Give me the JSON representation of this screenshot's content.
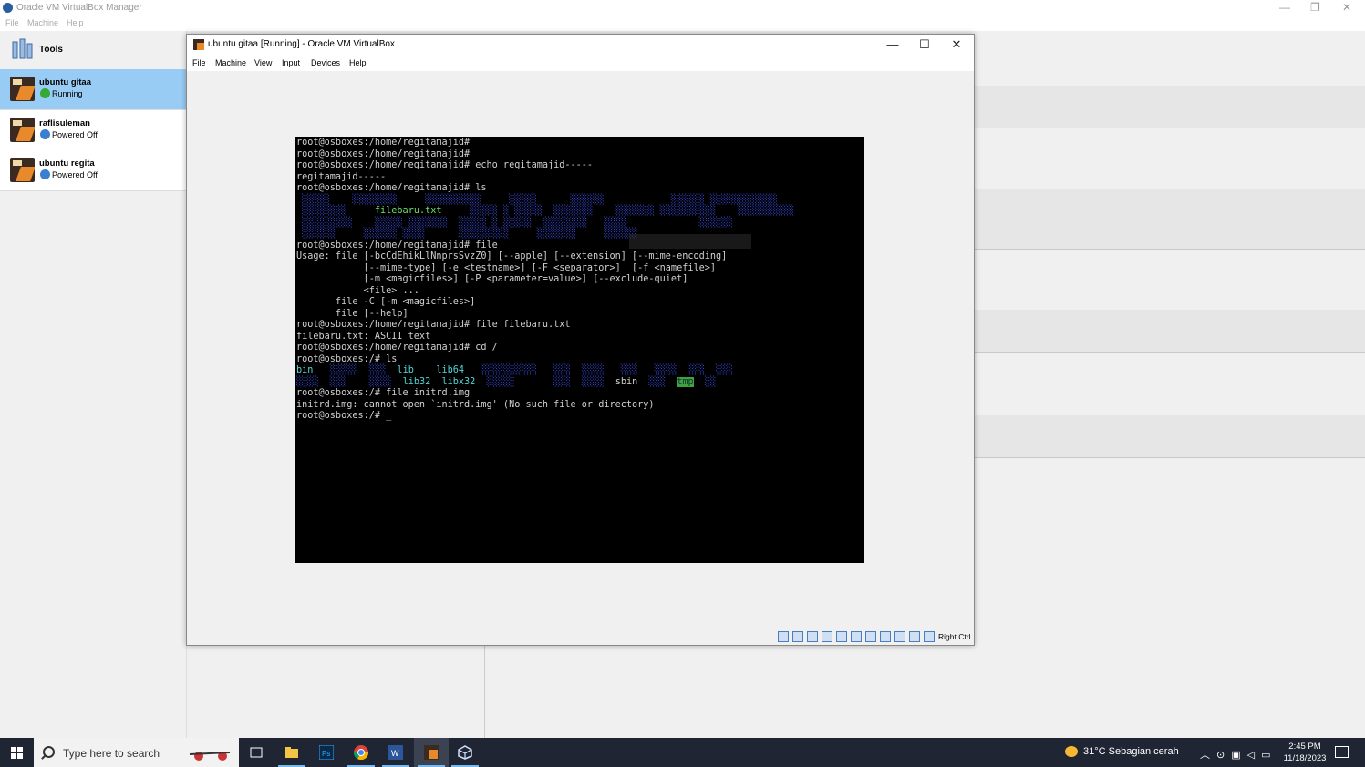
{
  "manager": {
    "title": "Oracle VM VirtualBox Manager",
    "menu": [
      "File",
      "Machine",
      "Help"
    ],
    "window_controls": [
      "—",
      "❐",
      "✕"
    ],
    "tools_label": "Tools",
    "vms": [
      {
        "name": "ubuntu gitaa",
        "status": "Running",
        "status_color": "#35a835",
        "selected": true
      },
      {
        "name": "raflisuleman",
        "status": "Powered Off",
        "status_color": "#3a7fd0",
        "selected": false
      },
      {
        "name": "ubuntu regita",
        "status": "Powered Off",
        "status_color": "#3a7fd0",
        "selected": false
      }
    ]
  },
  "vm_window": {
    "title": "ubuntu gitaa [Running] - Oracle VM VirtualBox",
    "menu": [
      "File",
      "Machine",
      "View",
      "Input",
      "Devices",
      "Help"
    ],
    "controls": {
      "minimize": "—",
      "maximize": "☐",
      "close": "✕"
    },
    "host_key": "Right Ctrl"
  },
  "terminal": {
    "lines": [
      "root@osboxes:/home/regitamajid#",
      "root@osboxes:/home/regitamajid#",
      "root@osboxes:/home/regitamajid# echo regitamajid-----",
      "regitamajid-----",
      "root@osboxes:/home/regitamajid# ls"
    ],
    "ls1_green": "filebaru.txt",
    "lines_after_ls1": [
      "root@osboxes:/home/regitamajid# file",
      "Usage: file [-bcCdEhikLlNnprsSvzZ0] [--apple] [--extension] [--mime-encoding]",
      "            [--mime-type] [-e <testname>] [-F <separator>]  [-f <namefile>]",
      "            [-m <magicfiles>] [-P <parameter=value>] [--exclude-quiet]",
      "            <file> ...",
      "       file -C [-m <magicfiles>]",
      "       file [--help]",
      "root@osboxes:/home/regitamajid# file filebaru.txt",
      "filebaru.txt: ASCII text",
      "root@osboxes:/home/regitamajid# cd /",
      "root@osboxes:/# ls"
    ],
    "ls2": {
      "bin": "bin",
      "lib": "lib",
      "lib64": "lib64",
      "lib32": "lib32",
      "libx32": "libx32",
      "sbin": "sbin",
      "tmp": "tmp"
    },
    "lines_end": [
      "root@osboxes:/# file initrd.img",
      "initrd.img: cannot open `initrd.img' (No such file or directory)",
      "root@osboxes:/# _"
    ]
  },
  "taskbar": {
    "search_placeholder": "Type here to search",
    "weather": "31°C  Sebagian cerah",
    "time": "2:45 PM",
    "date": "11/18/2023"
  }
}
